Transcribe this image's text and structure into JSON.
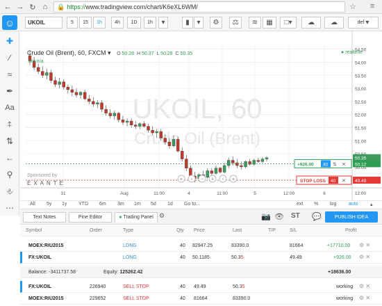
{
  "browser": {
    "url_scheme": "https://",
    "url_host": "www.tradingview.com",
    "url_path": "/chart/K6eXL6WM/"
  },
  "toolbar": {
    "symbol": "UKOIL",
    "intervals": [
      "5",
      "15",
      "1h",
      "4h",
      "1D",
      "1h"
    ],
    "layout_label": "def"
  },
  "chart": {
    "legend_title": "Crude Oil (Brent), 60, FXCM",
    "ohlc": {
      "o_label": "O",
      "o": "50.28",
      "h_label": "H",
      "h": "50.37",
      "l_label": "L",
      "l": "50.28",
      "c_label": "C",
      "c": "50.35"
    },
    "indicator_row": "n/a  n/a",
    "realtime_label": "realtime",
    "watermark_symbol": "UKOIL, 60",
    "watermark_name": "Crude Oil (Brent)",
    "sponsor_label": "Sponsored by",
    "sponsor_name": "EXANTE",
    "price_axis": [
      "54.50",
      "54.00",
      "53.50",
      "53.00",
      "52.50",
      "52.00",
      "51.50",
      "51.00",
      "50.50",
      "50.00",
      "49.50"
    ],
    "time_axis": [
      "31",
      "Aug",
      "11:00",
      "4",
      "11:00",
      "5",
      "12:00",
      "6",
      "12:00"
    ],
    "tags": {
      "current_high": "50.35",
      "current": "50.12",
      "stop": "49.49"
    },
    "take_profit": {
      "label": "+926.00",
      "qty": "40"
    },
    "stop_loss": {
      "label": "STOP LOSS",
      "qty": "40"
    }
  },
  "chart_data": {
    "type": "candlestick",
    "xlabel": "",
    "ylabel": "",
    "ylim": [
      49.2,
      54.65
    ],
    "candles": [
      [
        54.25,
        54.45,
        53.9,
        54.05
      ],
      [
        54.05,
        54.2,
        53.7,
        53.8
      ],
      [
        53.8,
        53.95,
        53.55,
        53.65
      ],
      [
        53.65,
        53.85,
        53.4,
        53.5
      ],
      [
        53.5,
        53.75,
        53.35,
        53.6
      ],
      [
        53.6,
        53.7,
        53.2,
        53.3
      ],
      [
        53.3,
        53.45,
        53.05,
        53.15
      ],
      [
        53.15,
        53.4,
        53.0,
        53.25
      ],
      [
        53.25,
        53.35,
        52.95,
        53.05
      ],
      [
        53.05,
        53.15,
        52.8,
        52.95
      ],
      [
        52.95,
        53.1,
        52.7,
        52.85
      ],
      [
        52.85,
        53.0,
        52.65,
        52.75
      ],
      [
        52.75,
        52.9,
        52.6,
        52.85
      ],
      [
        52.85,
        52.95,
        52.55,
        52.6
      ],
      [
        52.6,
        52.75,
        52.4,
        52.5
      ],
      [
        52.5,
        52.65,
        52.3,
        52.4
      ],
      [
        52.4,
        52.55,
        52.25,
        52.45
      ],
      [
        52.45,
        52.55,
        52.1,
        52.2
      ],
      [
        52.2,
        52.35,
        51.95,
        52.05
      ],
      [
        52.05,
        52.2,
        51.85,
        51.95
      ],
      [
        51.95,
        52.15,
        51.8,
        52.05
      ],
      [
        52.05,
        52.1,
        51.7,
        51.8
      ],
      [
        51.8,
        51.95,
        51.6,
        51.7
      ],
      [
        51.7,
        51.85,
        51.55,
        51.75
      ],
      [
        51.75,
        51.85,
        51.5,
        51.6
      ],
      [
        51.6,
        51.75,
        51.45,
        51.55
      ],
      [
        51.55,
        51.7,
        51.45,
        51.65
      ],
      [
        51.65,
        51.75,
        51.5,
        51.55
      ],
      [
        51.55,
        51.65,
        51.3,
        51.4
      ],
      [
        51.4,
        51.55,
        51.2,
        51.3
      ],
      [
        51.3,
        51.45,
        51.1,
        51.35
      ],
      [
        51.35,
        51.45,
        51.0,
        51.1
      ],
      [
        51.1,
        51.25,
        50.85,
        50.95
      ],
      [
        50.95,
        51.1,
        50.7,
        50.8
      ],
      [
        50.8,
        51.2,
        50.75,
        51.05
      ],
      [
        51.05,
        51.15,
        50.55,
        50.6
      ],
      [
        50.6,
        50.75,
        50.2,
        50.3
      ],
      [
        50.3,
        50.45,
        49.85,
        49.95
      ],
      [
        49.95,
        50.05,
        49.55,
        49.65
      ],
      [
        49.65,
        49.8,
        49.4,
        49.55
      ],
      [
        49.55,
        49.75,
        49.45,
        49.7
      ],
      [
        49.7,
        49.85,
        49.55,
        49.6
      ],
      [
        49.6,
        49.95,
        49.55,
        49.85
      ],
      [
        49.85,
        49.95,
        49.65,
        49.75
      ],
      [
        49.75,
        50.05,
        49.7,
        49.95
      ],
      [
        49.95,
        50.0,
        49.75,
        49.8
      ],
      [
        49.8,
        50.15,
        49.75,
        50.05
      ],
      [
        50.05,
        50.35,
        49.95,
        50.25
      ],
      [
        50.25,
        50.4,
        50.05,
        50.15
      ],
      [
        50.15,
        50.3,
        49.95,
        50.05
      ],
      [
        50.05,
        50.2,
        49.9,
        50.0
      ],
      [
        50.0,
        50.25,
        49.95,
        50.2
      ],
      [
        50.2,
        50.3,
        50.05,
        50.1
      ],
      [
        50.1,
        50.3,
        50.05,
        50.25
      ],
      [
        50.25,
        50.35,
        50.15,
        50.2
      ],
      [
        50.2,
        50.37,
        50.15,
        50.3
      ],
      [
        50.3,
        50.4,
        50.2,
        50.35
      ]
    ]
  },
  "timeframes": [
    "All",
    "5y",
    "1y",
    "YTD",
    "6m",
    "3m",
    "1m",
    "5d",
    "1d",
    "Go to..."
  ],
  "chart_options": [
    "ext",
    "%",
    "log",
    "auto"
  ],
  "panel": {
    "tabs": [
      "Text Notes",
      "Pine Editor",
      "Trading Panel"
    ],
    "publish_label": "PUBLISH IDEA",
    "icons": [
      "camera-icon",
      "eye-icon",
      "stocktwits-icon"
    ],
    "st_label": "ST"
  },
  "table": {
    "headers": [
      "Symbol",
      "Order",
      "Type",
      "Qty",
      "Price",
      "Last",
      "T/P",
      "S/L",
      "Profit"
    ],
    "positions": [
      {
        "symbol": "MOEX:RIU2015",
        "order": "",
        "type": "LONG",
        "qty": "40",
        "price": "82947.25",
        "last": "83390.0",
        "tp": "",
        "sl": "81664",
        "profit": "+17710.00"
      },
      {
        "symbol": "FX:UKOIL",
        "order": "",
        "type": "LONG",
        "qty": "40",
        "price": "50.1185",
        "last_main": "50.3",
        "last_frac": "5",
        "tp": "",
        "sl": "49.49",
        "profit": "+926.00"
      }
    ],
    "balance": {
      "label": "Balance:",
      "value": "-3411737.58",
      "equity_label": "Equity:",
      "equity": "125262.42",
      "profit": "+18636.00"
    },
    "orders": [
      {
        "symbol": "FX:UKOIL",
        "order": "226940",
        "type": "SELL STOP",
        "qty": "40",
        "price": "49.49",
        "last_main": "50.3",
        "last_frac": "5",
        "status": "working"
      },
      {
        "symbol": "MOEX:RIU2015",
        "order": "229652",
        "type": "SELL STOP",
        "qty": "40",
        "price": "81664",
        "last": "83390.0",
        "status": "working"
      }
    ]
  },
  "colors": {
    "accent": "#2196f3",
    "up": "#2e9e54",
    "down": "#c0392b",
    "sell": "#e53935"
  }
}
